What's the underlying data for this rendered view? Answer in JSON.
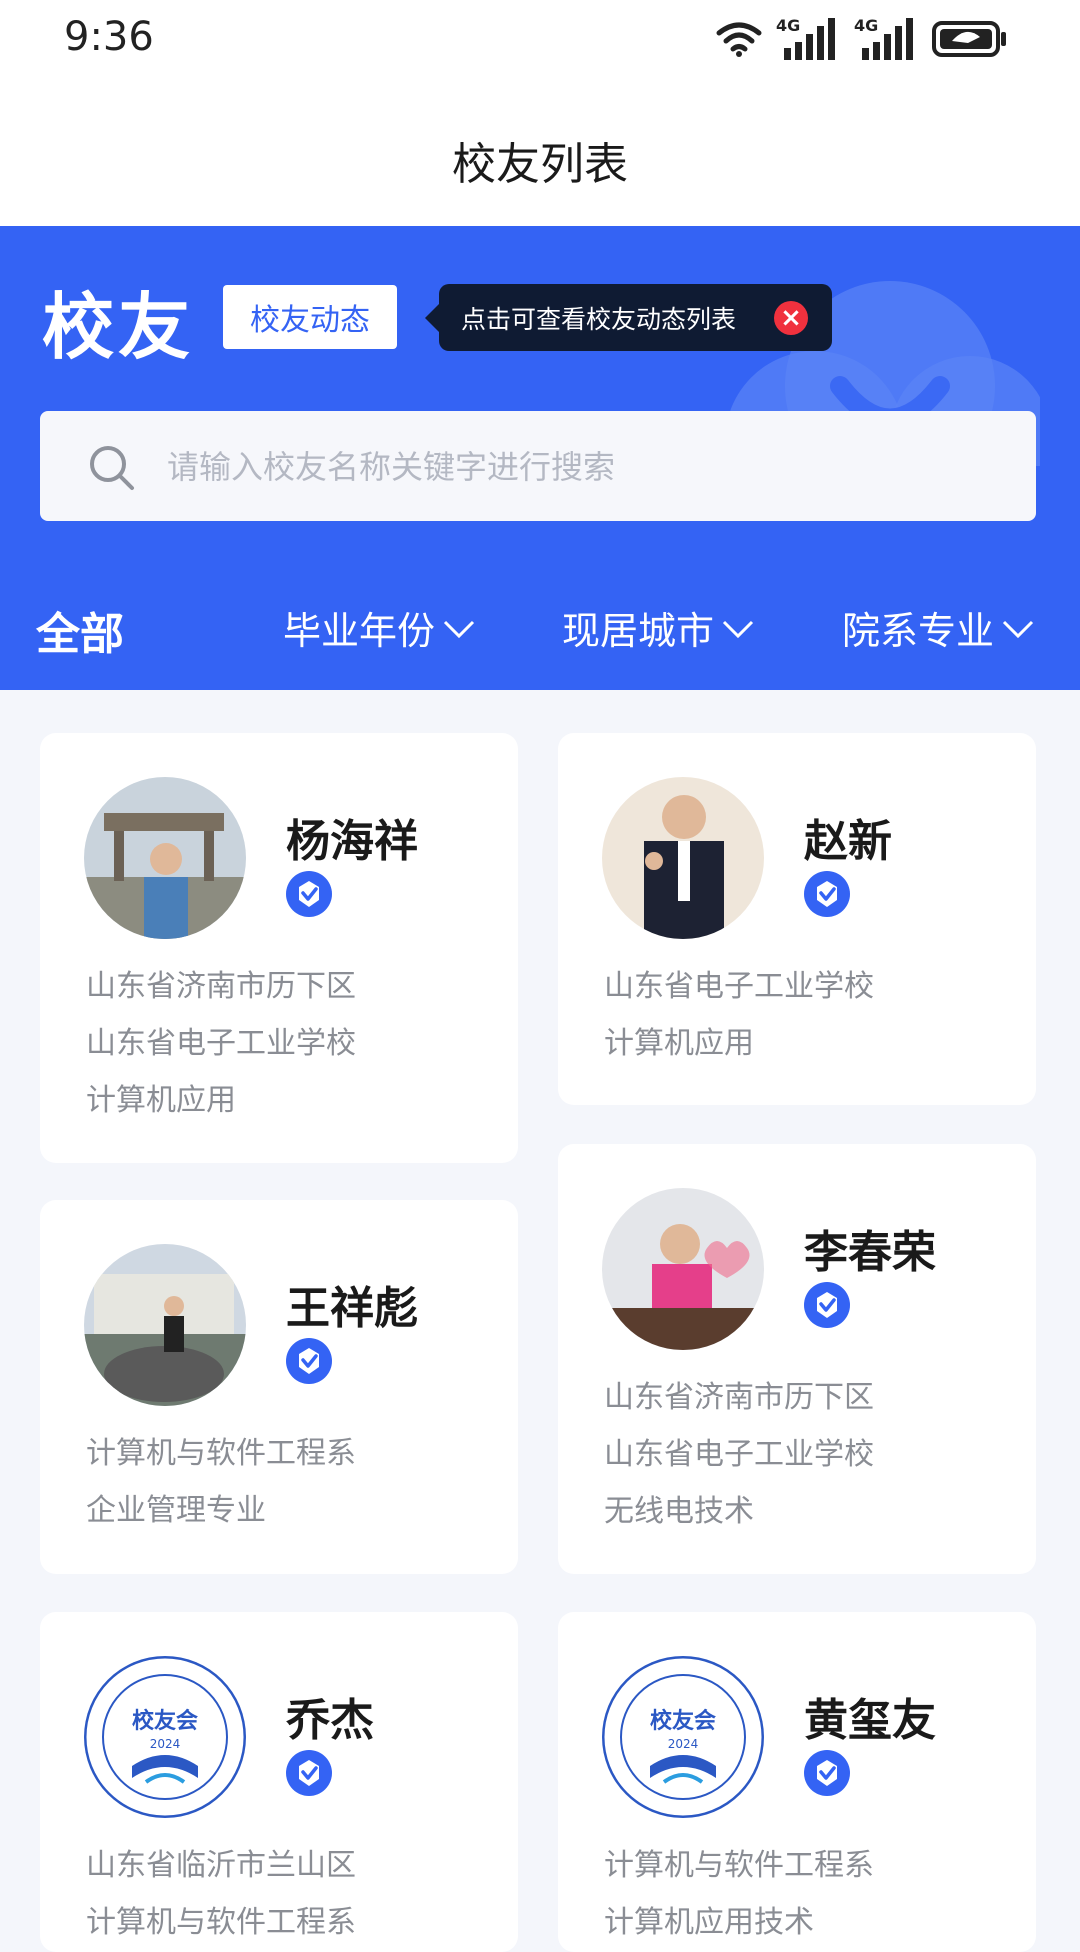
{
  "status_bar": {
    "time": "9:36",
    "network_1": "4G",
    "network_2": "4G"
  },
  "header": {
    "title": "校友列表"
  },
  "hero": {
    "heading": "校友",
    "tag_button": "校友动态",
    "tooltip": "点击可查看校友动态列表"
  },
  "search": {
    "placeholder": "请输入校友名称关键字进行搜索"
  },
  "filters": {
    "all": "全部",
    "year": "毕业年份",
    "city": "现居城市",
    "major": "院系专业"
  },
  "alumni": [
    {
      "name": "杨海祥",
      "lines": [
        "山东省济南市历下区",
        "山东省电子工业学校",
        "计算机应用"
      ]
    },
    {
      "name": "赵新",
      "lines": [
        "山东省电子工业学校",
        "计算机应用"
      ]
    },
    {
      "name": "王祥彪",
      "lines": [
        "计算机与软件工程系",
        "企业管理专业"
      ]
    },
    {
      "name": "李春荣",
      "lines": [
        "山东省济南市历下区",
        "山东省电子工业学校",
        "无线电技术"
      ]
    },
    {
      "name": "乔杰",
      "lines": [
        "山东省临沂市兰山区",
        "计算机与软件工程系"
      ]
    },
    {
      "name": "黄玺友",
      "lines": [
        "计算机与软件工程系",
        "计算机应用技术"
      ]
    }
  ],
  "logo": {
    "text": "校友会",
    "year": "2024"
  },
  "colors": {
    "primary": "#3463f4",
    "tooltip_bg": "#0f1b33",
    "close_red": "#f0313e",
    "page_bg": "#f4f6fb"
  }
}
